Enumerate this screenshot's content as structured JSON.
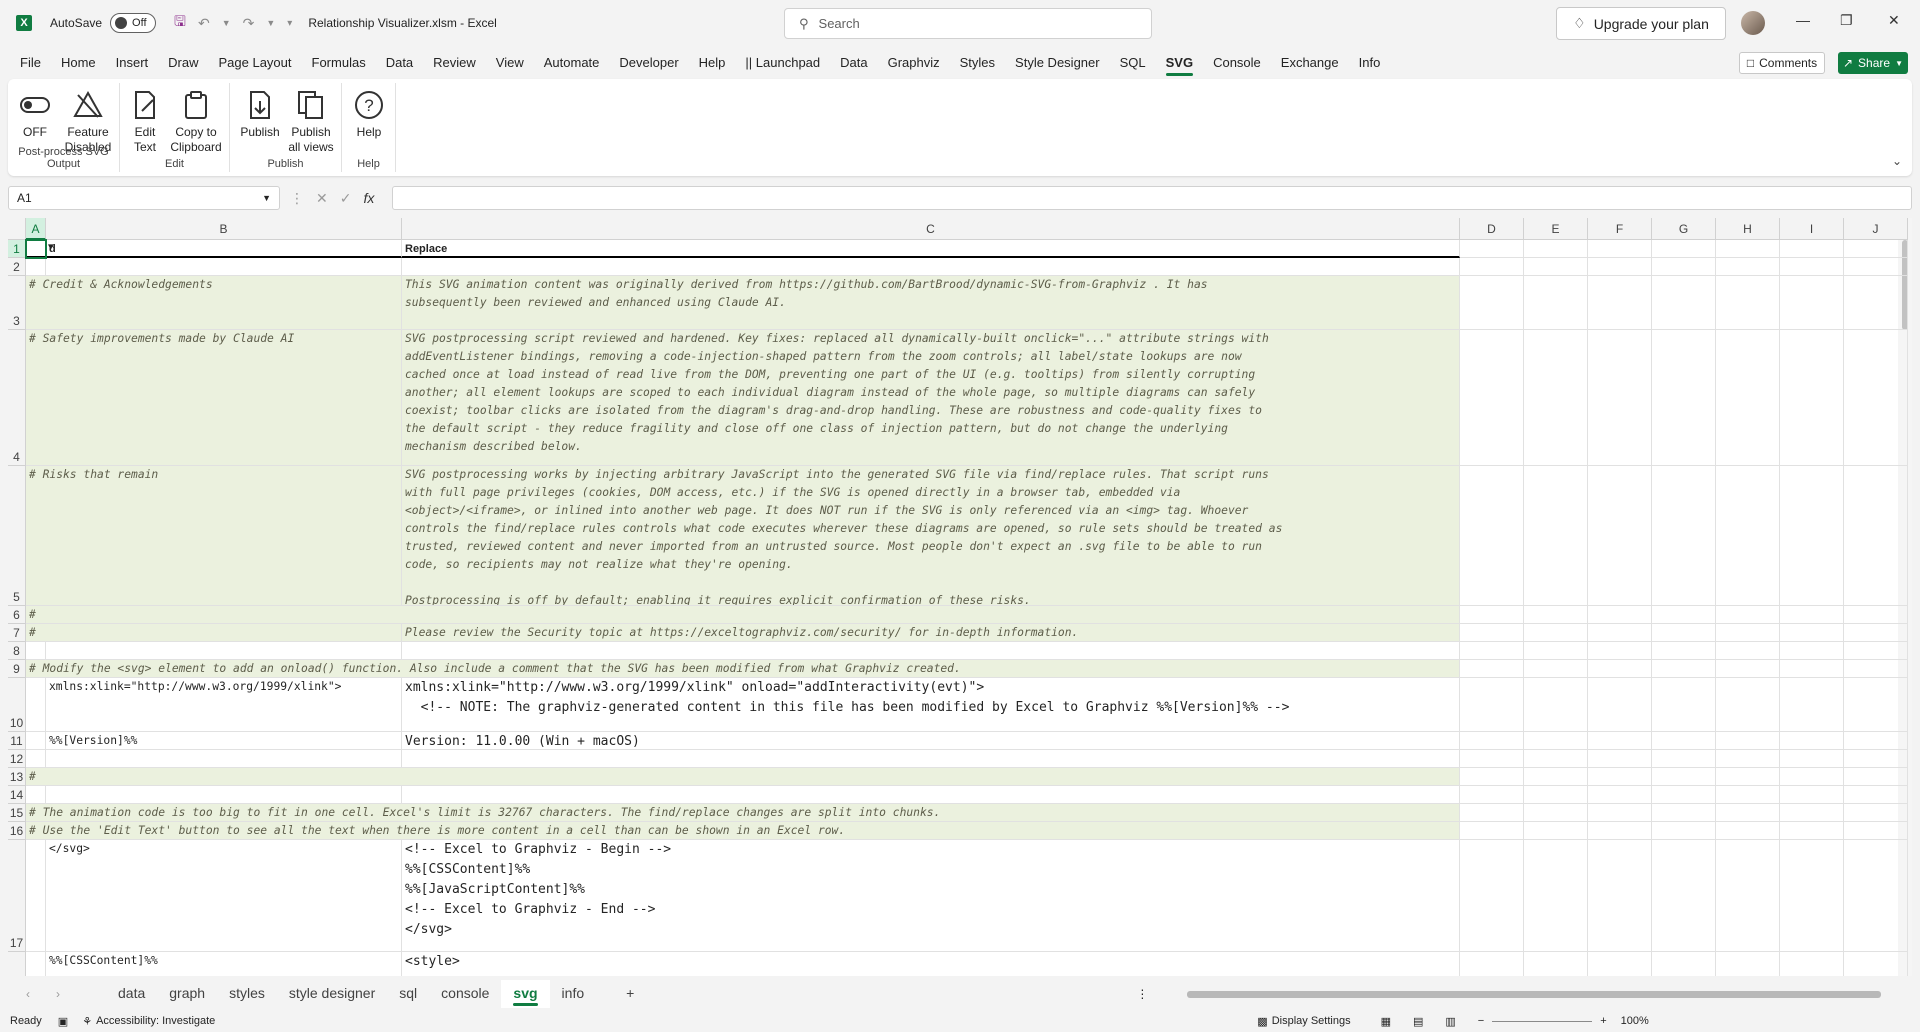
{
  "titlebar": {
    "autosave_label": "AutoSave",
    "autosave_state": "Off",
    "document_title": "Relationship Visualizer.xlsm  -  Excel",
    "search_placeholder": "Search",
    "upgrade_label": "Upgrade your plan"
  },
  "menu": {
    "items": [
      "File",
      "Home",
      "Insert",
      "Draw",
      "Page Layout",
      "Formulas",
      "Data",
      "Review",
      "View",
      "Automate",
      "Developer",
      "Help",
      "|| Launchpad",
      "Data",
      "Graphviz",
      "Styles",
      "Style Designer",
      "SQL",
      "SVG",
      "Console",
      "Exchange",
      "Info"
    ],
    "active_index": 18,
    "comments_label": "Comments",
    "share_label": "Share"
  },
  "ribbon": {
    "groups": [
      {
        "label": "Post-process SVG Output",
        "buttons": [
          "OFF",
          "Feature\nDisabled"
        ]
      },
      {
        "label": "Edit",
        "buttons": [
          "Edit\nText",
          "Copy to\nClipboard"
        ]
      },
      {
        "label": "Publish",
        "buttons": [
          "Publish",
          "Publish\nall views"
        ]
      },
      {
        "label": "Help",
        "buttons": [
          "Help"
        ]
      }
    ]
  },
  "formula_bar": {
    "name_box": "A1",
    "formula": ""
  },
  "grid": {
    "columns": [
      "A",
      "B",
      "C",
      "D",
      "E",
      "F",
      "G",
      "H",
      "I",
      "J"
    ],
    "row_numbers": [
      "1",
      "2",
      "3",
      "4",
      "5",
      "6",
      "7",
      "8",
      "9",
      "10",
      "11",
      "12",
      "13",
      "14",
      "15",
      "16",
      "17"
    ],
    "cells": {
      "r1_b": "d",
      "r1_c": "Replace",
      "r3_b": "# Credit & Acknowledgements",
      "r3_c": "This SVG animation content was originally derived from https://github.com/BartBrood/dynamic-SVG-from-Graphviz . It has\nsubsequently been reviewed and enhanced using Claude AI.",
      "r4_b": "# Safety improvements made by Claude AI",
      "r4_c": "SVG postprocessing script reviewed and hardened. Key fixes: replaced all dynamically-built onclick=\"...\" attribute strings with\naddEventListener bindings, removing a code-injection-shaped pattern from the zoom controls; all label/state lookups are now\ncached once at load instead of read live from the DOM, preventing one part of the UI (e.g. tooltips) from silently corrupting\nanother; all element lookups are scoped to each individual diagram instead of the whole page, so multiple diagrams can safely\ncoexist; toolbar clicks are isolated from the diagram's drag-and-drop handling. These are robustness and code-quality fixes to\nthe default script - they reduce fragility and close off one class of injection pattern, but do not change the underlying\nmechanism described below.",
      "r5_b": "# Risks that remain",
      "r5_c": "SVG postprocessing works by injecting arbitrary JavaScript into the generated SVG file via find/replace rules. That script runs\nwith full page privileges (cookies, DOM access, etc.) if the SVG is opened directly in a browser tab, embedded via\n<object>/<iframe>, or inlined into another web page. It does NOT run if the SVG is only referenced via an <img> tag. Whoever\ncontrols the find/replace rules controls what code executes wherever these diagrams are opened, so rule sets should be treated as\ntrusted, reviewed content and never imported from an untrusted source. Most people don't expect an .svg file to be able to run\ncode, so recipients may not realize what they're opening.\n\nPostprocessing is off by default; enabling it requires explicit confirmation of these risks.",
      "r6_b": "#",
      "r7_b": "#",
      "r7_c": "Please review the Security topic at https://exceltographviz.com/security/ for in-depth information.",
      "r9_b": "# Modify the <svg> element to add an onload() function. Also include a comment that the SVG has been modified from what Graphviz created.",
      "r10_b": "xmlns:xlink=\"http://www.w3.org/1999/xlink\">",
      "r10_c": "xmlns:xlink=\"http://www.w3.org/1999/xlink\" onload=\"addInteractivity(evt)\">\n  <!-- NOTE: The graphviz-generated content in this file has been modified by Excel to Graphviz %%[Version]%% -->",
      "r11_b": "%%[Version]%%",
      "r11_c": "Version: 11.0.00 (Win + macOS)",
      "r13_b": "#",
      "r15_b": "# The animation code is too big to fit in one cell. Excel's limit is 32767 characters. The find/replace changes are split into chunks.",
      "r16_b": "# Use the 'Edit Text' button to see all the text when there is more content in a cell than can be shown in an Excel row.",
      "r17_b": "</svg>",
      "r17_c": "<!-- Excel to Graphviz - Begin -->\n%%[CSSContent]%%\n%%[JavaScriptContent]%%\n<!-- Excel to Graphviz - End -->\n</svg>",
      "r18_b": "%%[CSSContent]%%",
      "r18_c": "<style>"
    }
  },
  "sheet_tabs": {
    "tabs": [
      "data",
      "graph",
      "styles",
      "style designer",
      "sql",
      "console",
      "svg",
      "info"
    ],
    "active_index": 6,
    "add_label": "+"
  },
  "status": {
    "ready": "Ready",
    "accessibility": "Accessibility: Investigate",
    "display_settings": "Display Settings",
    "zoom": "100%"
  },
  "colors": {
    "accent": "#107c41",
    "comment_fill": "#ebf1de"
  }
}
